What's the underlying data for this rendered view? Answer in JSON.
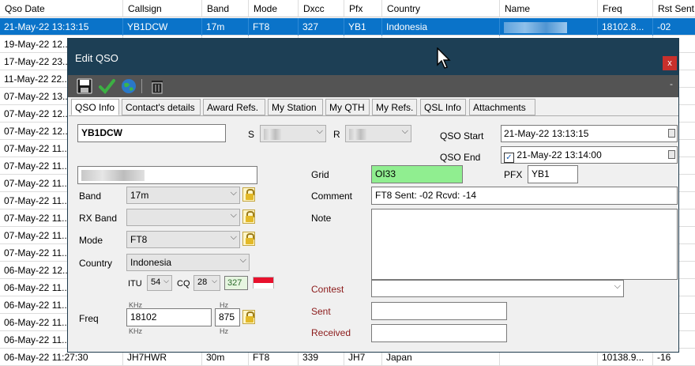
{
  "grid": {
    "columns": [
      "Qso Date",
      "Callsign",
      "Band",
      "Mode",
      "Dxcc",
      "Pfx",
      "Country",
      "Name",
      "Freq",
      "Rst Sent"
    ],
    "rows": [
      {
        "date": "21-May-22 13:13:15",
        "call": "YB1DCW",
        "band": "17m",
        "mode": "FT8",
        "dxcc": "327",
        "pfx": "YB1",
        "country": "Indonesia",
        "freq": "18102.8...",
        "rst": "-02",
        "selected": true
      },
      {
        "date": "19-May-22 12..."
      },
      {
        "date": "17-May-22 23..."
      },
      {
        "date": "11-May-22 22..."
      },
      {
        "date": "07-May-22 13..."
      },
      {
        "date": "07-May-22 12..."
      },
      {
        "date": "07-May-22 12..."
      },
      {
        "date": "07-May-22 11..."
      },
      {
        "date": "07-May-22 11..."
      },
      {
        "date": "07-May-22 11..."
      },
      {
        "date": "07-May-22 11..."
      },
      {
        "date": "07-May-22 11..."
      },
      {
        "date": "07-May-22 11..."
      },
      {
        "date": "07-May-22 11..."
      },
      {
        "date": "06-May-22 12..."
      },
      {
        "date": "06-May-22 11..."
      },
      {
        "date": "06-May-22 11..."
      },
      {
        "date": "06-May-22 11..."
      },
      {
        "date": "06-May-22 11..."
      },
      {
        "date": "06-May-22 11:27:30",
        "call": "JH7HWR",
        "band": "30m",
        "mode": "FT8",
        "dxcc": "339",
        "pfx": "JH7",
        "country": "Japan",
        "freq": "10138.9...",
        "rst": "-16"
      }
    ]
  },
  "dialog": {
    "title": "Edit QSO",
    "close": "x",
    "toolbar": {
      "icons": [
        "save-icon",
        "check-icon",
        "globe-icon",
        "trash-icon"
      ],
      "minimize": "-"
    },
    "tabs": [
      "QSO Info",
      "Contact's details",
      "Award Refs.",
      "My Station",
      "My QTH",
      "My Refs.",
      "QSL Info",
      "Attachments"
    ],
    "active_tab": "QSO Info",
    "callsign": "YB1DCW",
    "s_label": "S",
    "r_label": "R",
    "qso_start_label": "QSO Start",
    "qso_start": "21-May-22 13:13:15",
    "qso_end_label": "QSO End",
    "qso_end": "21-May-22 13:14:00",
    "grid_label": "Grid",
    "grid": "OI33",
    "pfx_label": "PFX",
    "pfx": "YB1",
    "comment_label": "Comment",
    "comment": "FT8  Sent: -02  Rcvd: -14",
    "note_label": "Note",
    "band_label": "Band",
    "band": "17m",
    "rx_band_label": "RX Band",
    "rx_band": "",
    "mode_label": "Mode",
    "mode": "FT8",
    "country_label": "Country",
    "country": "Indonesia",
    "itu_label": "ITU",
    "itu": "54",
    "cq_label": "CQ",
    "cq": "28",
    "dxcc": "327",
    "freq_label": "Freq",
    "khz_label": "KHz",
    "freq_khz": "18102",
    "hz_label": "Hz",
    "freq_hz": "875",
    "contest_label": "Contest",
    "sent_label": "Sent",
    "received_label": "Received",
    "colors": {
      "grid_bg": "#90ee90",
      "titlebar": "#1d3f55",
      "selected_row": "#0a73c9"
    }
  }
}
